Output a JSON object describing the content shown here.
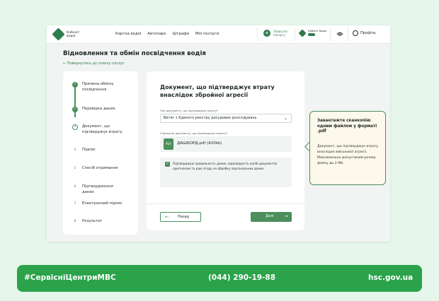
{
  "header": {
    "logo_text": "Кабінет\nводія",
    "nav": [
      "Картка водія",
      "Автопарк",
      "Штрафи",
      "Мої послуги"
    ],
    "cta_text": "Записати послугу",
    "logo2_text": "Кабінет Водія",
    "profile_label": "Профіль"
  },
  "page": {
    "title": "Відновлення та обмін посвідчення водія",
    "back_link": "← Повернутись до списку послуг"
  },
  "steps": [
    {
      "num": "✓",
      "label": "Причина обміну посвідчення",
      "state": "done"
    },
    {
      "num": "✓",
      "label": "Перевірка даних",
      "state": "done"
    },
    {
      "num": "3",
      "label": "Документ, що підтверджує втрату",
      "state": "cur"
    },
    {
      "num": "4",
      "label": "Підпис",
      "state": "todo"
    },
    {
      "num": "5",
      "label": "Спосіб отримання",
      "state": "todo"
    },
    {
      "num": "6",
      "label": "Підтвердження даних",
      "state": "todo"
    },
    {
      "num": "7",
      "label": "Електронний підпис",
      "state": "todo"
    },
    {
      "num": "8",
      "label": "Результат",
      "state": "todo"
    }
  ],
  "form": {
    "title": "Документ, що підтверджує втрату внаслідок збройної агресії",
    "doc_type_label": "Тип документу, що підтверджує втрату*",
    "doc_type_value": "Витяг з Єдиного реєстру досудових розслідувань",
    "scan_label": "Сканкопія документу, що підтверджує втрату*",
    "file_type": "PDF",
    "file_name": "ДАШБОРД.pdf (420kb)",
    "consent_text": "Підтверджую правильність даних, відповідність копій документів оригіналам та даю згоду на обробку персональних даних",
    "back_button": "Назад",
    "next_button": "Далі"
  },
  "tooltip": {
    "title": "Завантажте сканкопію одним файлом у форматі .pdf",
    "text": "Документ, що підтверджує втрату внаслідок військової агресії. Максимально допустимий розмір файлу до 2 Мб."
  },
  "footer": {
    "hashtag": "#СервісніЦентриМВС",
    "phone": "(044) 290-19-88",
    "site": "hsc.gov.ua"
  },
  "colors": {
    "brand": "#4a8f5c",
    "footer_bg": "#2aa34a",
    "page_bg": "#e6f6ea"
  }
}
